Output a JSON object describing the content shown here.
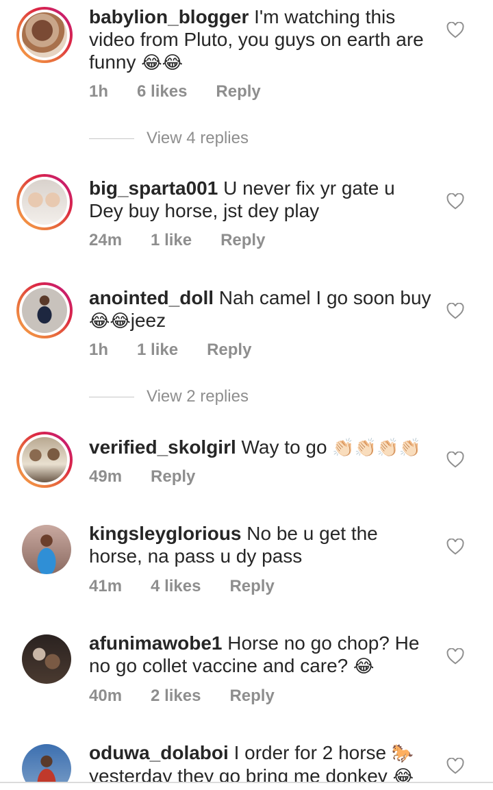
{
  "comments": [
    {
      "username": "babylion_blogger",
      "text": "I'm watching this video from Pluto, you guys on earth are funny",
      "emoji": "😂😂",
      "time": "1h",
      "likes": "6 likes",
      "reply": "Reply",
      "view_replies": "View 4 replies"
    },
    {
      "username": "big_sparta001",
      "text": "U never fix yr gate u Dey buy horse, jst dey play",
      "emoji": "",
      "time": "24m",
      "likes": "1 like",
      "reply": "Reply"
    },
    {
      "username": "anointed_doll",
      "text": "Nah camel I go soon buy",
      "emoji": "😂😂",
      "text_after": "jeez",
      "time": "1h",
      "likes": "1 like",
      "reply": "Reply",
      "view_replies": "View 2 replies"
    },
    {
      "username": "verified_skolgirl",
      "text": "Way to go",
      "emoji": "👏🏻👏🏻👏🏻👏🏻",
      "time": "49m",
      "likes": "",
      "reply": "Reply"
    },
    {
      "username": "kingsleyglorious",
      "text": "No be u get the horse, na pass u dy pass",
      "emoji": "",
      "time": "41m",
      "likes": "4 likes",
      "reply": "Reply"
    },
    {
      "username": "afunimawobe1",
      "text": "Horse no go chop? He no go collet vaccine and care?",
      "emoji": "😂",
      "time": "40m",
      "likes": "2 likes",
      "reply": "Reply"
    },
    {
      "username": "oduwa_dolaboi",
      "text": "I order for 2 horse",
      "emoji": "🐎",
      "text_after": "yesterday they go bring me donkey",
      "emoji_after": "😂",
      "time": "",
      "likes": "",
      "reply": ""
    }
  ],
  "icons": {
    "like": "heart-outline-icon"
  },
  "colors": {
    "text": "#262626",
    "meta": "#8e8e8e",
    "ring_start": "#f9a84a",
    "ring_end": "#bc1888"
  }
}
